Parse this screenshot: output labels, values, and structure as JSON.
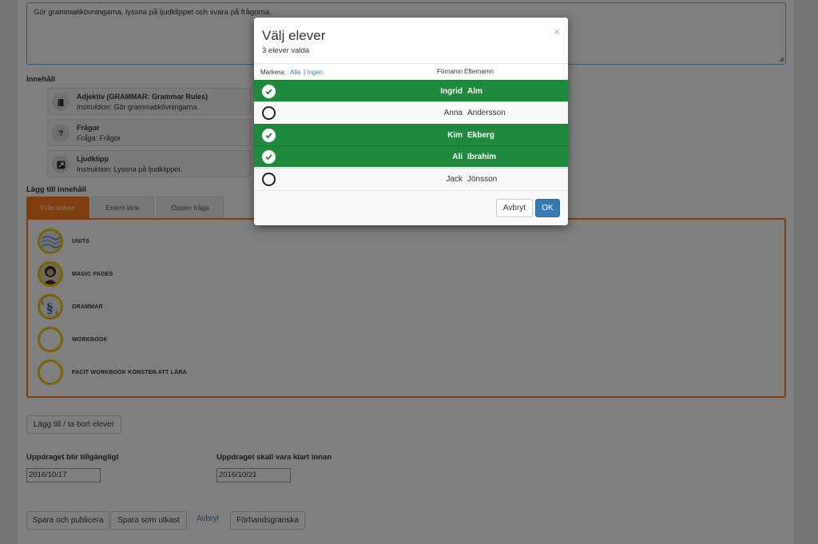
{
  "assignment": {
    "description": "Gör grammatikövningarna, lyssna på ljudklippet och svara på frågorna."
  },
  "content_section": {
    "label": "Innehåll",
    "items": [
      {
        "title": "Adjektiv (GRAMMAR: Grammar Rules)",
        "sub_label": "Instruktion:",
        "sub_value": "Gör grammatikövningarna.",
        "icon": "book-icon"
      },
      {
        "title": "Frågor",
        "sub_label": "Fråga:",
        "sub_value": "Frågor",
        "icon": "question-icon"
      },
      {
        "title": "Ljudklipp",
        "sub_label": "Instruktion:",
        "sub_value": "Lyssna på ljudklippet.",
        "icon": "external-link-icon"
      }
    ]
  },
  "add_content": {
    "label": "Lägg till innehåll",
    "tabs": [
      {
        "label": "Från boken",
        "active": true
      },
      {
        "label": "Extern länk",
        "active": false
      },
      {
        "label": "Öppen fråga",
        "active": false
      }
    ],
    "books": [
      {
        "label": "UNITS"
      },
      {
        "label": "MAGIC PAGES"
      },
      {
        "label": "GRAMMAR"
      },
      {
        "label": "WORKBOOK"
      },
      {
        "label": "FACIT WORKBOOK KONSTEN ATT LÄRA"
      }
    ]
  },
  "students_button": "Lägg till / ta bort elever",
  "dates": {
    "available_label": "Uppdraget blir tillgängligt",
    "available_value": "2016/10/17",
    "due_label": "Uppdraget skall vara klart innan",
    "due_value": "2016/10/21"
  },
  "actions": {
    "save_publish": "Spara och publicera",
    "save_draft": "Spara som utkast",
    "cancel": "Avbryt",
    "preview": "Förhandsgranska"
  },
  "modal": {
    "title": "Välj elever",
    "subtitle": "3 elever valda",
    "close": "×",
    "select_label": "Markera:",
    "select_all": "Alla",
    "separator": "|",
    "select_none": "Ingen",
    "col_first": "Förnamn",
    "col_last": "Efternamn",
    "students": [
      {
        "first": "Ingrid",
        "last": "Alm",
        "selected": true
      },
      {
        "first": "Anna",
        "last": "Andersson",
        "selected": false
      },
      {
        "first": "Kim",
        "last": "Ekberg",
        "selected": true
      },
      {
        "first": "Ali",
        "last": "Ibrahim",
        "selected": true
      },
      {
        "first": "Jack",
        "last": "Jönsson",
        "selected": false
      }
    ],
    "cancel": "Avbryt",
    "ok": "OK"
  },
  "colors": {
    "accent_orange": "#ff7a1a",
    "selected_green": "#1f8a3b",
    "primary_blue": "#337ab7",
    "book_ring": "#f3c400"
  }
}
